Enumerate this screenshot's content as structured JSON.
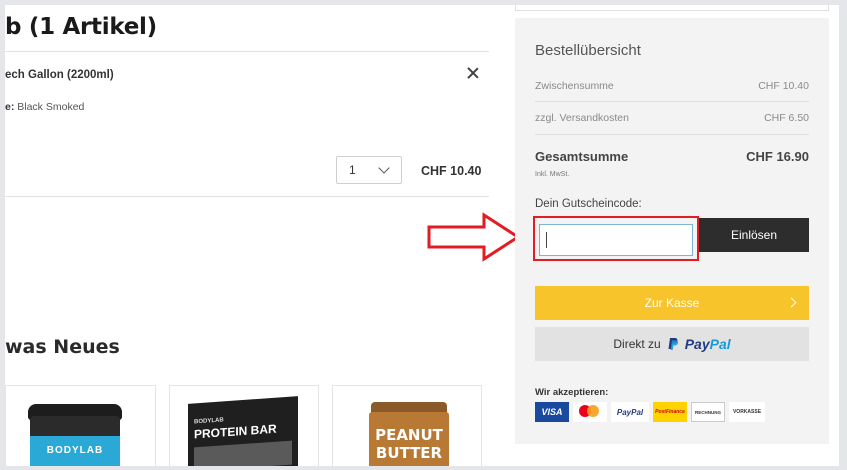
{
  "cart": {
    "title": "b (1 Artikel)",
    "item_name": "ech Gallon (2200ml)",
    "variant_label": "e:",
    "variant_value": " Black Smoked",
    "quantity": "1",
    "line_price": "CHF 10.40"
  },
  "recommendations": {
    "title": "was Neues",
    "products": [
      {
        "brand": "BODYLAB"
      },
      {
        "brand": "BODYLAB",
        "label": "PROTEIN BAR"
      },
      {
        "label": "PEANUT BUTTER"
      }
    ]
  },
  "summary": {
    "title": "Bestellübersicht",
    "subtotal_label": "Zwischensumme",
    "subtotal_value": "CHF 10.40",
    "shipping_label": "zzgl. Versandkosten",
    "shipping_value": "CHF 6.50",
    "total_label": "Gesamtsumme",
    "total_value": "CHF 16.90",
    "vat_note": "Inkl. MwSt.",
    "voucher_label": "Dein Gutscheincode:",
    "voucher_value": "",
    "voucher_placeholder": "",
    "redeem_label": "Einlösen",
    "checkout_label": "Zur Kasse",
    "paypal_prefix": "Direkt zu",
    "paypal_word_1": "Pay",
    "paypal_word_2": "Pal",
    "accept_label": "Wir akzeptieren:",
    "payment_methods": {
      "visa": "VISA",
      "mastercard": "mastercard",
      "paypal": "PayPal",
      "postfinance": "PostFinance",
      "rechnung": "RECHNUNG",
      "vorkasse": "VORKASSE"
    }
  },
  "colors": {
    "checkout_accent": "#f8c42b",
    "redeem_button": "#2d2d2d",
    "annotation_red": "#e31b23"
  }
}
